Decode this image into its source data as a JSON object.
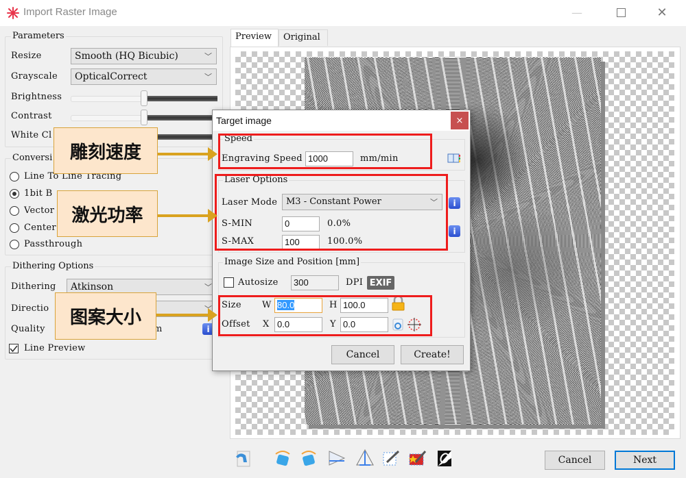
{
  "window": {
    "title": "Import Raster Image",
    "minimize_icon": "minimize-icon",
    "maximize_icon": "maximize-icon",
    "close_icon": "close-icon"
  },
  "parameters": {
    "legend": "Parameters",
    "resize_label": "Resize",
    "resize_value": "Smooth (HQ Bicubic)",
    "grayscale_label": "Grayscale",
    "grayscale_value": "OpticalCorrect",
    "brightness_label": "Brightness",
    "brightness_value": 0.5,
    "contrast_label": "Contrast",
    "contrast_value": 0.5,
    "white_clip_label": "White Cl"
  },
  "conversion": {
    "legend": "Conversi",
    "options": [
      {
        "label": "Line To Line Tracing",
        "selected": false
      },
      {
        "label": "1bit B",
        "selected": true
      },
      {
        "label": "Vector",
        "selected": false
      },
      {
        "label": "Center",
        "selected": false
      },
      {
        "label": "Passthrough",
        "selected": false
      }
    ]
  },
  "dithering": {
    "legend": "Dithering Options",
    "dithering_label": "Dithering",
    "dithering_value": "Atkinson",
    "direction_label": "Directio",
    "quality_label": "Quality",
    "quality_unit_fragment": "m",
    "line_preview_label": "Line Preview",
    "line_preview_checked": true
  },
  "callouts": {
    "speed": "雕刻速度",
    "power": "激光功率",
    "size": "图案大小"
  },
  "preview": {
    "tabs": [
      {
        "label": "Preview",
        "active": true
      },
      {
        "label": "Original",
        "active": false
      }
    ]
  },
  "toolbar": {
    "icons": [
      "reset-icon",
      "rotate-right-icon",
      "rotate-left-icon",
      "flip-horizontal-icon",
      "flip-vertical-icon",
      "crop-icon",
      "auto-trim-icon",
      "invert-icon"
    ],
    "cancel_label": "Cancel",
    "next_label": "Next"
  },
  "dialog": {
    "title": "Target image",
    "close_glyph": "×",
    "speed": {
      "legend": "Speed",
      "engraving_speed_label": "Engraving Speed",
      "engraving_speed_value": "1000",
      "unit": "mm/min"
    },
    "laser": {
      "legend": "Laser Options",
      "mode_label": "Laser Mode",
      "mode_value": "M3 - Constant Power",
      "smin_label": "S-MIN",
      "smin_value": "0",
      "smin_percent": "0.0%",
      "smax_label": "S-MAX",
      "smax_value": "100",
      "smax_percent": "100.0%"
    },
    "size": {
      "legend": "Image Size and Position [mm]",
      "autosize_label": "Autosize",
      "autosize_checked": false,
      "dpi_value": "300",
      "dpi_label": "DPI",
      "exif_label": "EXIF",
      "size_label": "Size",
      "w_label": "W",
      "w_value": "80.0",
      "h_label": "H",
      "h_value": "100.0",
      "offset_label": "Offset",
      "x_label": "X",
      "x_value": "0.0",
      "y_label": "Y",
      "y_value": "0.0"
    },
    "cancel_label": "Cancel",
    "create_label": "Create!"
  }
}
